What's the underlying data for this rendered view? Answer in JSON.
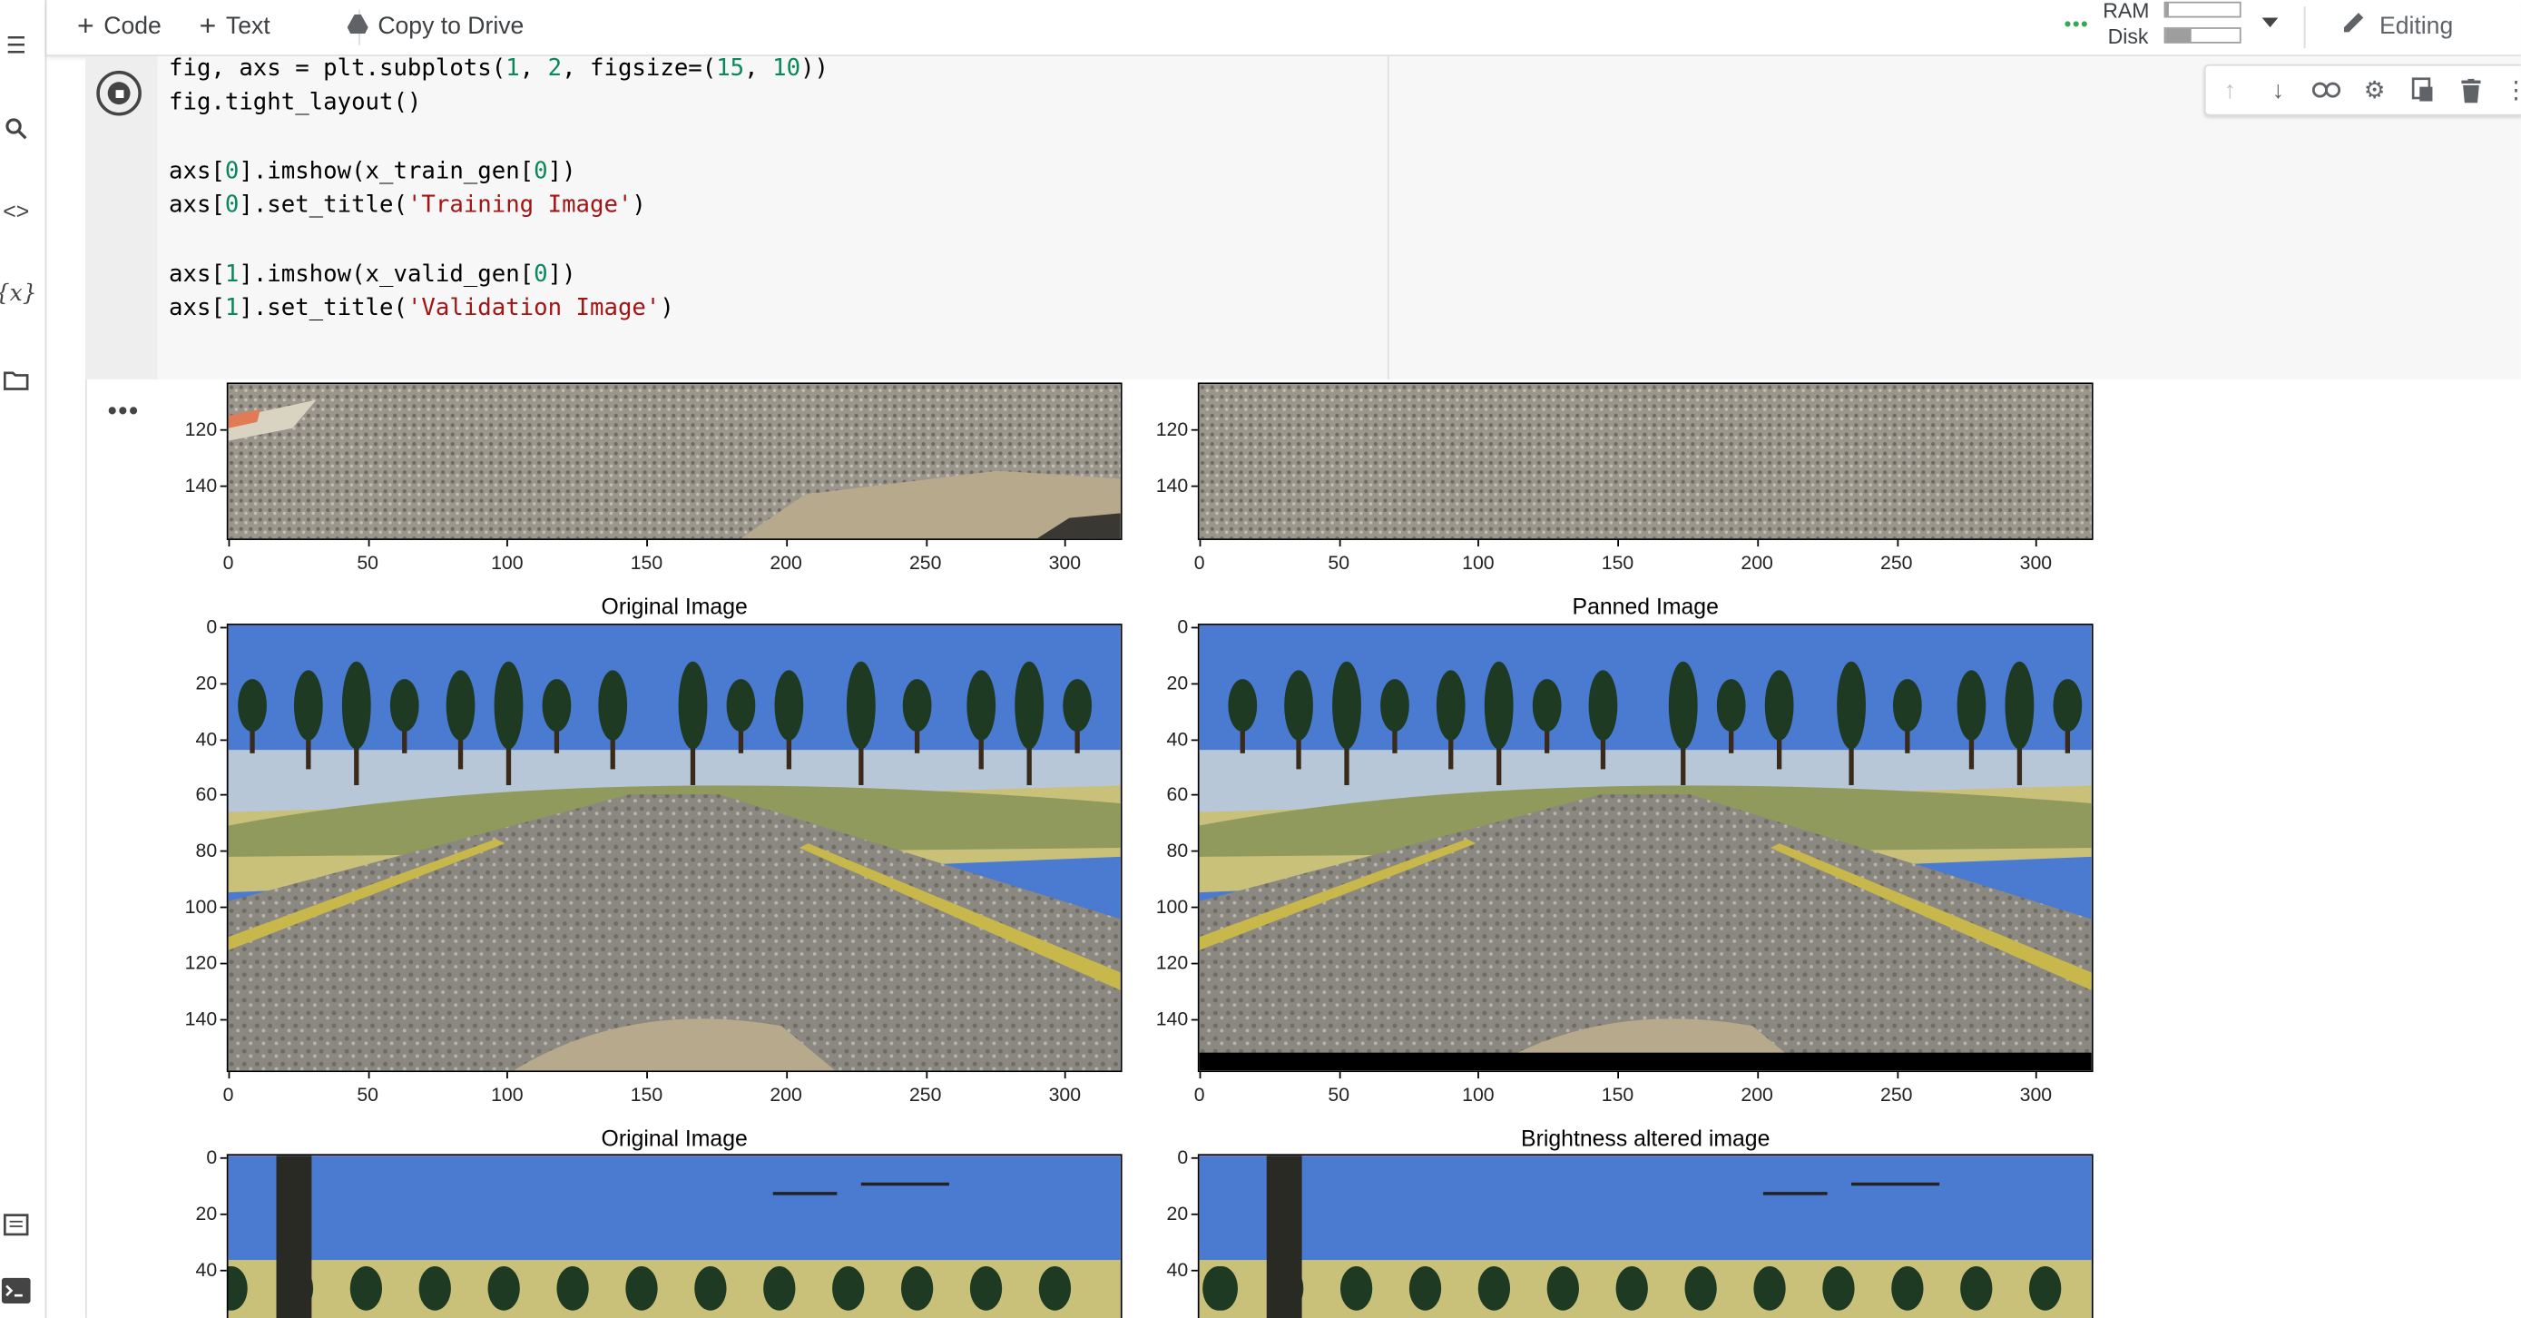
{
  "toolbar": {
    "code_label": "Code",
    "text_label": "Text",
    "copy_label": "Copy to Drive",
    "ram_label": "RAM",
    "disk_label": "Disk",
    "ram_fraction": 0.05,
    "disk_fraction": 0.35,
    "editing_label": "Editing"
  },
  "cell": {
    "code_lines": [
      [
        "fig, axs = plt.subplots(",
        {
          "n": "1"
        },
        ", ",
        {
          "n": "2"
        },
        ", figsize=(",
        {
          "n": "15"
        },
        ", ",
        {
          "n": "10"
        },
        "))"
      ],
      [
        "fig.tight_layout()"
      ],
      [
        ""
      ],
      [
        "axs[",
        {
          "n": "0"
        },
        "].imshow(x_train_gen[",
        {
          "n": "0"
        },
        "])"
      ],
      [
        "axs[",
        {
          "n": "0"
        },
        "].set_title(",
        {
          "s": "'Training Image'"
        },
        ")"
      ],
      [
        ""
      ],
      [
        "axs[",
        {
          "n": "1"
        },
        "].imshow(x_valid_gen[",
        {
          "n": "0"
        },
        "])"
      ],
      [
        "axs[",
        {
          "n": "1"
        },
        "].set_title(",
        {
          "s": "'Validation Image'"
        },
        ")"
      ]
    ]
  },
  "output": {
    "dots": "•••",
    "rows": [
      {
        "left_title": "",
        "right_title": "",
        "yticks": [
          "120",
          "140"
        ],
        "xticks": [
          "0",
          "50",
          "100",
          "150",
          "200",
          "250",
          "300"
        ]
      },
      {
        "left_title": "Original Image",
        "right_title": "Panned Image",
        "yticks": [
          "0",
          "20",
          "40",
          "60",
          "80",
          "100",
          "120",
          "140"
        ],
        "xticks": [
          "0",
          "50",
          "100",
          "150",
          "200",
          "250",
          "300"
        ]
      },
      {
        "left_title": "Original Image",
        "right_title": "Brightness altered image",
        "yticks": [
          "0",
          "20",
          "40"
        ],
        "xticks": []
      }
    ]
  },
  "colors": {
    "sky": "#4a7bd0",
    "road": "#8a8880",
    "grass": "#c9c07a",
    "tree": "#1f3a22",
    "hood": "#b6a98c"
  }
}
